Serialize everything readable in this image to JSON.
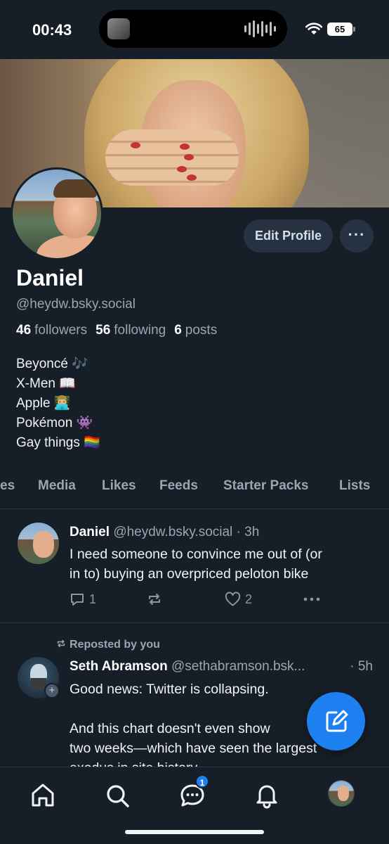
{
  "status_bar": {
    "time": "00:43",
    "battery": "65"
  },
  "profile": {
    "edit_button": "Edit Profile",
    "more_button": "···",
    "display_name": "Daniel",
    "handle": "@heydw.bsky.social",
    "stats": {
      "followers_count": "46",
      "followers_label": "followers",
      "following_count": "56",
      "following_label": "following",
      "posts_count": "6",
      "posts_label": "posts"
    },
    "bio": [
      "Beyoncé 🎶",
      "X-Men 📖",
      "Apple 👨🏼‍💻",
      "Pokémon 👾",
      "Gay things 🏳️‍🌈"
    ]
  },
  "tabs": [
    "es",
    "Media",
    "Likes",
    "Feeds",
    "Starter Packs",
    "Lists"
  ],
  "posts": [
    {
      "author": "Daniel",
      "handle": "@heydw.bsky.social",
      "time": "· 3h",
      "lines": [
        "I need someone to convince me out of (or",
        "in to) buying an overpriced peloton bike"
      ],
      "replies": "1",
      "likes": "2"
    },
    {
      "repost_label": "Reposted by you",
      "author": "Seth Abramson",
      "handle": "@sethabramson.bsk...",
      "time": "· 5h",
      "lines": [
        "Good news: Twitter is collapsing.",
        "",
        "And this chart doesn't even show",
        "two weeks—which have seen the largest",
        "exodus in site history"
      ]
    }
  ],
  "bottom_nav": {
    "chat_badge": "1"
  },
  "icons": [
    "home-icon",
    "search-icon",
    "chat-icon",
    "bell-icon",
    "compose-icon",
    "reply-icon",
    "repost-icon",
    "heart-icon",
    "more-icon",
    "wifi-icon"
  ],
  "colors": {
    "background": "#161e27",
    "accent": "#1e7ff0",
    "muted": "#9aa6b2"
  }
}
